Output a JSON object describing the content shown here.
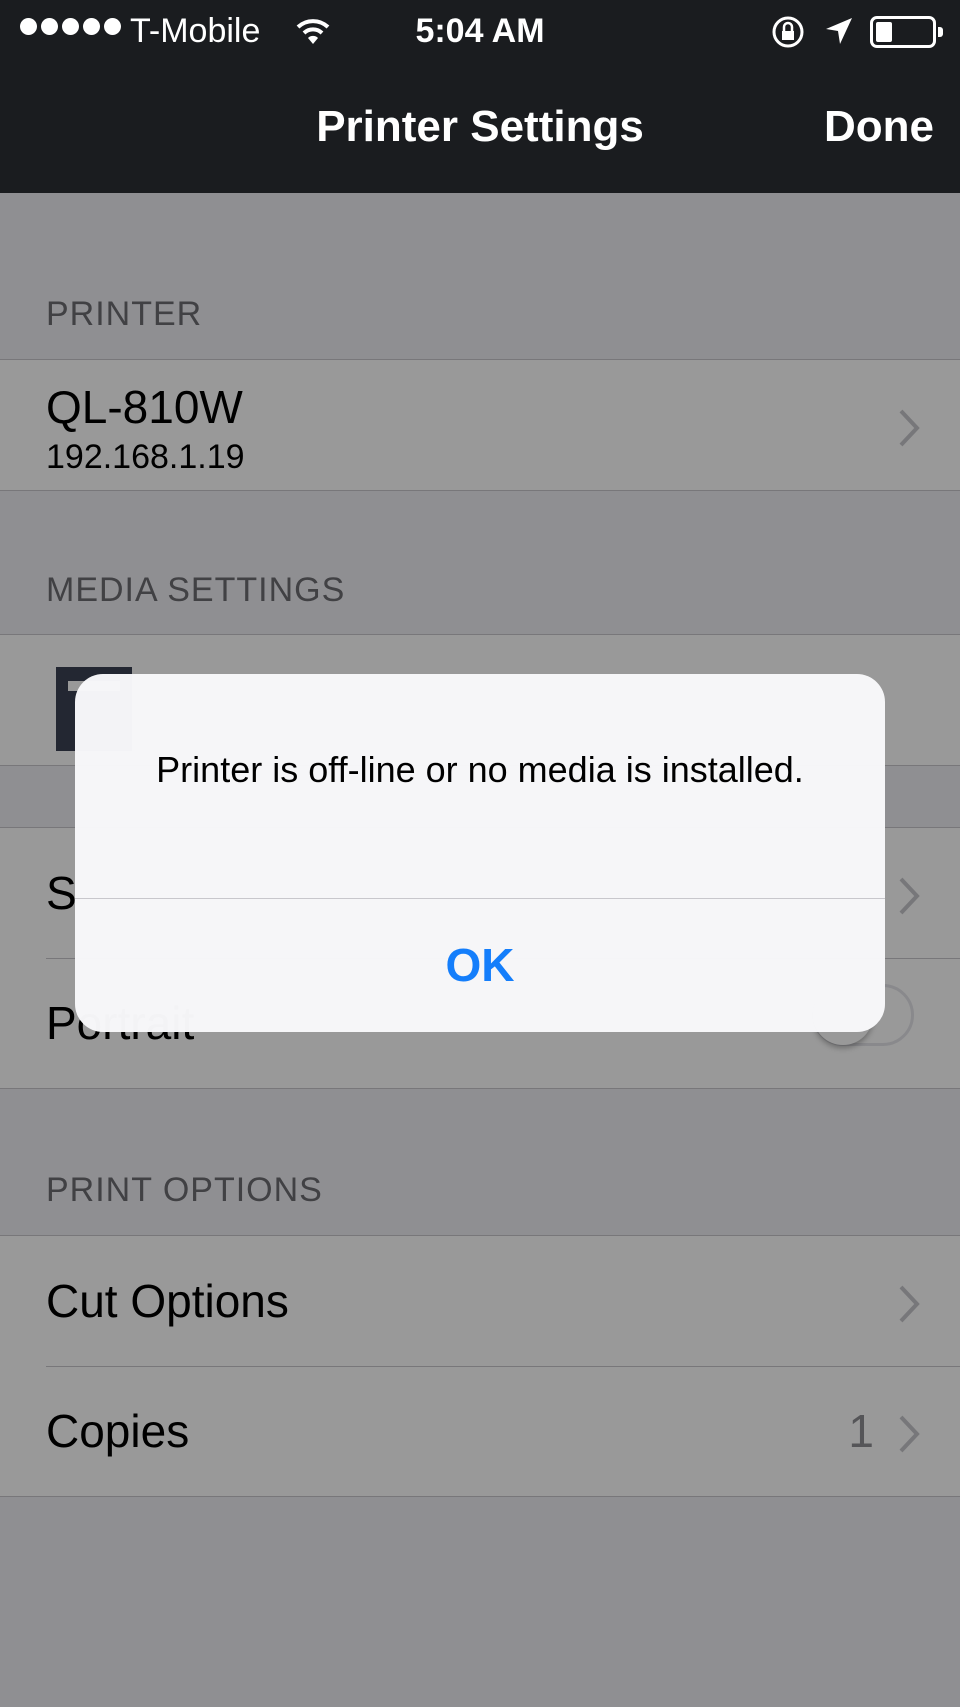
{
  "status_bar": {
    "carrier": "T-Mobile",
    "time": "5:04 AM",
    "signal_icon": "signal-dots-icon",
    "wifi_icon": "wifi-icon",
    "rotation_lock_icon": "rotation-lock-icon",
    "location_icon": "location-arrow-icon",
    "battery_icon": "battery-icon"
  },
  "nav": {
    "title": "Printer Settings",
    "done_label": "Done"
  },
  "sections": {
    "printer": {
      "header": "PRINTER",
      "model": "QL-810W",
      "ip": "192.168.1.19"
    },
    "media": {
      "header": "MEDIA SETTINGS"
    },
    "layout": {
      "row1_title": "S",
      "orientation_label": "Portrait"
    },
    "print_options": {
      "header": "PRINT OPTIONS",
      "cut_options_label": "Cut Options",
      "copies_label": "Copies",
      "copies_value": "1"
    }
  },
  "alert": {
    "message": "Printer is off-line or no media is installed.",
    "ok_label": "OK"
  },
  "colors": {
    "accent": "#147efb",
    "nav_background": "#1a1c1f"
  }
}
